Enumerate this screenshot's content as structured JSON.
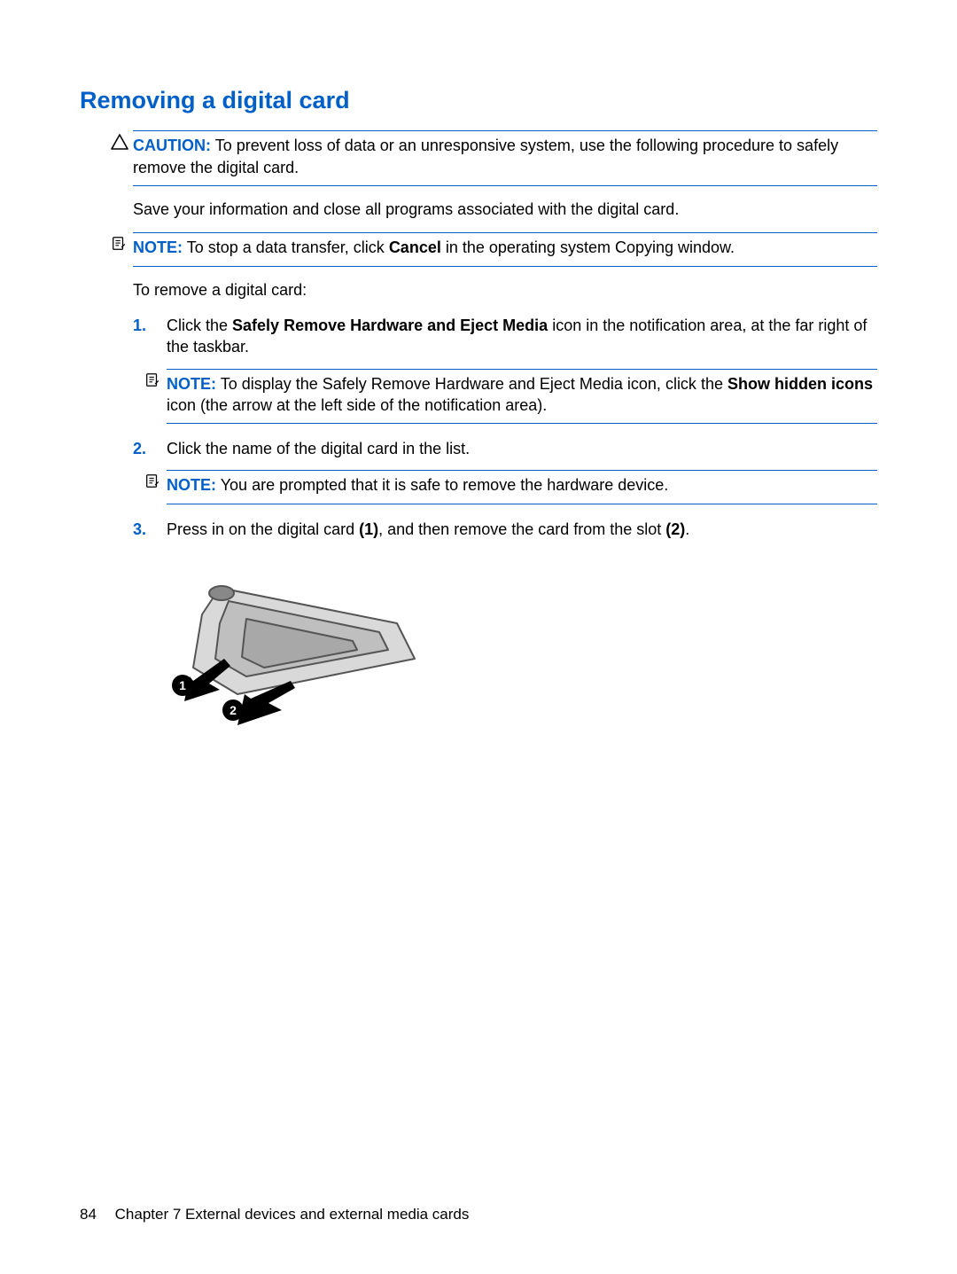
{
  "heading": "Removing a digital card",
  "caution_label": "CAUTION:",
  "caution_text": "To prevent loss of data or an unresponsive system, use the following procedure to safely remove the digital card.",
  "para_save": "Save your information and close all programs associated with the digital card.",
  "note_label": "NOTE:",
  "note1_before": "To stop a data transfer, click ",
  "note1_bold": "Cancel",
  "note1_after": " in the operating system Copying window.",
  "intro": "To remove a digital card:",
  "steps": {
    "s1": {
      "num": "1.",
      "pre": "Click the ",
      "bold": "Safely Remove Hardware and Eject Media",
      "post": " icon in the notification area, at the far right of the taskbar.",
      "note_pre": "To display the Safely Remove Hardware and Eject Media icon, click the ",
      "note_bold": "Show hidden icons",
      "note_post": " icon (the arrow at the left side of the notification area)."
    },
    "s2": {
      "num": "2.",
      "text": "Click the name of the digital card in the list.",
      "note_text": "You are prompted that it is safe to remove the hardware device."
    },
    "s3": {
      "num": "3.",
      "pre": "Press in on the digital card ",
      "b1": "(1)",
      "mid": ", and then remove the card from the slot ",
      "b2": "(2)",
      "end": "."
    }
  },
  "footer": {
    "page_number": "84",
    "chapter_text": "Chapter 7   External devices and external media cards"
  }
}
